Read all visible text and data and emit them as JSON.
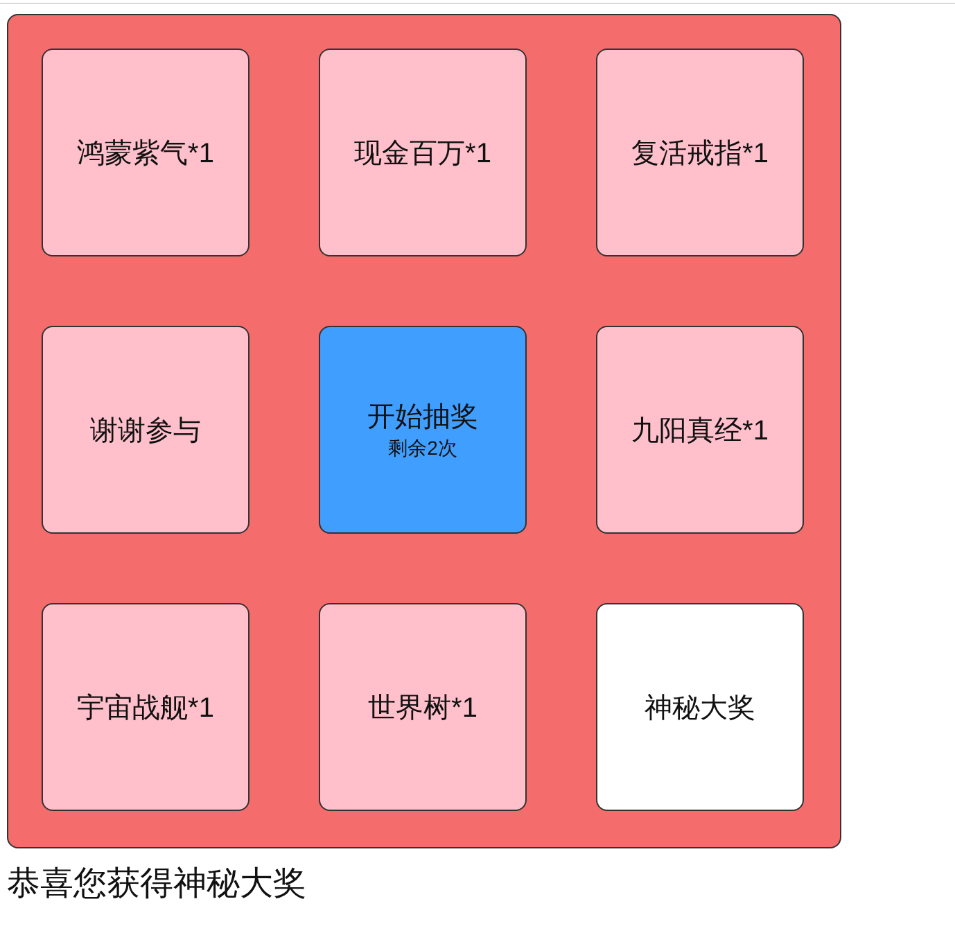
{
  "prizes": [
    {
      "label": "鸿蒙紫气*1",
      "selected": false
    },
    {
      "label": "现金百万*1",
      "selected": false
    },
    {
      "label": "复活戒指*1",
      "selected": false
    },
    {
      "label": "谢谢参与",
      "selected": false
    },
    {
      "label": "九阳真经*1",
      "selected": false
    },
    {
      "label": "宇宙战舰*1",
      "selected": false
    },
    {
      "label": "世界树*1",
      "selected": false
    },
    {
      "label": "神秘大奖",
      "selected": true
    }
  ],
  "start_button": {
    "label": "开始抽奖",
    "remaining": "剩余2次"
  },
  "result": "恭喜您获得神秘大奖"
}
